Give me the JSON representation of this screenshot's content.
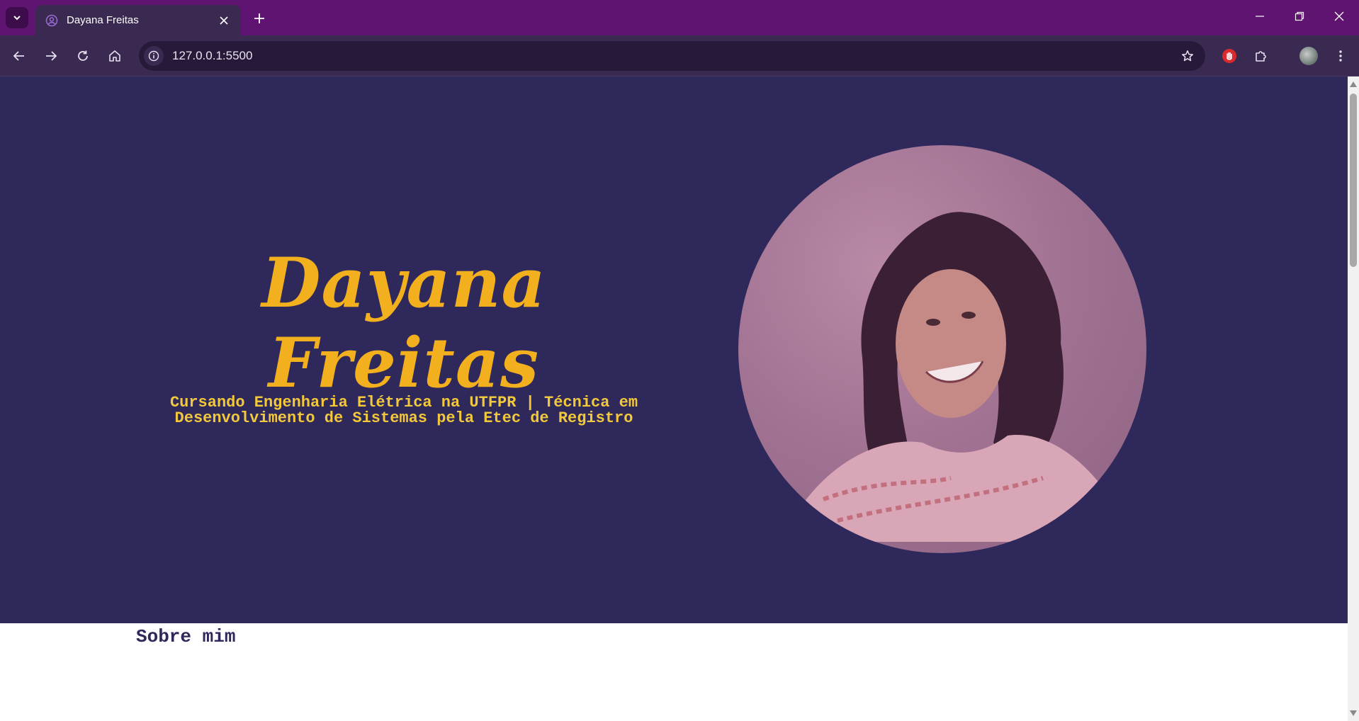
{
  "browser": {
    "tab_title": "Dayana Freitas",
    "url": "127.0.0.1:5500",
    "icons": {
      "tab_search": "chevron-down-icon",
      "favicon": "profile-icon",
      "close": "close-icon",
      "new_tab": "plus-icon",
      "back": "arrow-left-icon",
      "forward": "arrow-right-icon",
      "reload": "reload-icon",
      "home": "home-icon",
      "site_info": "info-icon",
      "bookmark": "star-icon",
      "extension_adblock": "hand-icon",
      "extensions": "puzzle-icon",
      "profile": "avatar",
      "menu": "kebab-menu-icon"
    },
    "colors": {
      "titlebar": "#5e1470",
      "toolbar": "#3a2a52"
    }
  },
  "page": {
    "hero": {
      "name": "Dayana Freitas",
      "subtitle_line1": "Cursando Engenharia Elétrica na UTFPR | Técnica em",
      "subtitle_line2": "Desenvolvimento de Sistemas pela Etec de Registro",
      "colors": {
        "background": "#2f285b",
        "name": "#f2b01e",
        "subtitle": "#f2c93a"
      }
    },
    "about": {
      "title": "Sobre mim"
    }
  }
}
